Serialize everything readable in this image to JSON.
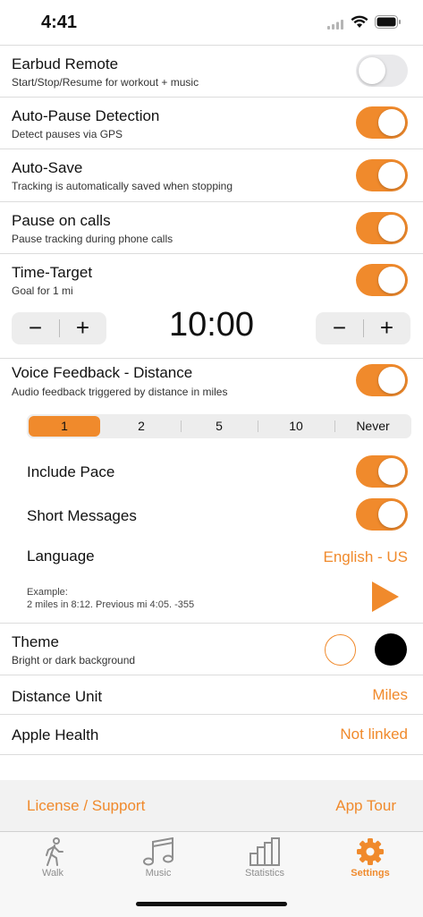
{
  "status": {
    "time": "4:41"
  },
  "settings": {
    "earbud": {
      "title": "Earbud Remote",
      "sub": "Start/Stop/Resume for workout + music",
      "on": false
    },
    "autopause": {
      "title": "Auto-Pause Detection",
      "sub": "Detect pauses via GPS",
      "on": true
    },
    "autosave": {
      "title": "Auto-Save",
      "sub": "Tracking is automatically saved when stopping",
      "on": true
    },
    "pausecalls": {
      "title": "Pause on calls",
      "sub": "Pause tracking during phone calls",
      "on": true
    },
    "timetarget": {
      "title": "Time-Target",
      "sub": "Goal for 1 mi",
      "on": true,
      "minus": "−",
      "plus": "+",
      "value": "10:00"
    },
    "voice": {
      "title": "Voice Feedback - Distance",
      "sub": "Audio feedback triggered by distance in miles",
      "on": true,
      "options": [
        "1",
        "2",
        "5",
        "10",
        "Never"
      ],
      "selected": "1"
    },
    "include_pace": {
      "title": "Include Pace",
      "on": true
    },
    "short_messages": {
      "title": "Short Messages",
      "on": true
    },
    "language": {
      "title": "Language",
      "value": "English - US"
    },
    "example": {
      "label": "Example:",
      "text": "2 miles in 8:12. Previous mi 4:05. -355"
    },
    "theme": {
      "title": "Theme",
      "sub": "Bright or dark background"
    },
    "distance_unit": {
      "title": "Distance Unit",
      "value": "Miles"
    },
    "apple_health": {
      "title": "Apple Health",
      "value": "Not linked"
    }
  },
  "footer": {
    "license": "License / Support",
    "tour": "App Tour"
  },
  "tabs": [
    {
      "label": "Walk",
      "icon": "walk-icon"
    },
    {
      "label": "Music",
      "icon": "music-icon"
    },
    {
      "label": "Statistics",
      "icon": "statistics-icon"
    },
    {
      "label": "Settings",
      "icon": "gear-icon",
      "active": true
    }
  ],
  "colors": {
    "accent": "#f08a2c",
    "toggle_off": "#e9e9eb",
    "footer_bg": "#f2f2f2"
  }
}
